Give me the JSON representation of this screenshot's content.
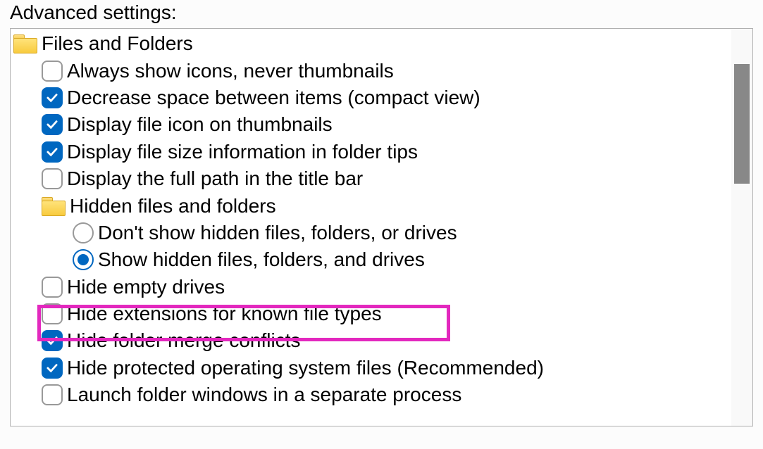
{
  "heading": "Advanced settings:",
  "tree": {
    "root_label": "Files and Folders",
    "items": [
      {
        "kind": "checkbox",
        "checked": false,
        "label": "Always show icons, never thumbnails"
      },
      {
        "kind": "checkbox",
        "checked": true,
        "label": "Decrease space between items (compact view)"
      },
      {
        "kind": "checkbox",
        "checked": true,
        "label": "Display file icon on thumbnails"
      },
      {
        "kind": "checkbox",
        "checked": true,
        "label": "Display file size information in folder tips"
      },
      {
        "kind": "checkbox",
        "checked": false,
        "label": "Display the full path in the title bar"
      },
      {
        "kind": "folder",
        "label": "Hidden files and folders"
      },
      {
        "kind": "radio",
        "selected": false,
        "label": "Don't show hidden files, folders, or drives"
      },
      {
        "kind": "radio",
        "selected": true,
        "label": "Show hidden files, folders, and drives"
      },
      {
        "kind": "checkbox",
        "checked": false,
        "label": "Hide empty drives"
      },
      {
        "kind": "checkbox",
        "checked": false,
        "label": "Hide extensions for known file types",
        "highlighted": true
      },
      {
        "kind": "checkbox",
        "checked": true,
        "label": "Hide folder merge conflicts"
      },
      {
        "kind": "checkbox",
        "checked": true,
        "label": "Hide protected operating system files (Recommended)"
      },
      {
        "kind": "checkbox",
        "checked": false,
        "label": "Launch folder windows in a separate process"
      }
    ]
  }
}
